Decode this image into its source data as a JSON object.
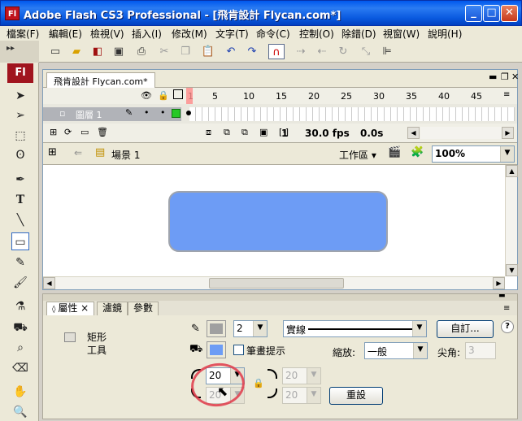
{
  "window": {
    "title": "Adobe Flash CS3 Professional - [飛肯設計  Flycan.com*]",
    "icon_text": "Fl",
    "minimize": "_",
    "maximize": "□",
    "close": "✕"
  },
  "menu": [
    "檔案(F)",
    "編輯(E)",
    "檢視(V)",
    "插入(I)",
    "修改(M)",
    "文字(T)",
    "命令(C)",
    "控制(O)",
    "除錯(D)",
    "視窗(W)",
    "說明(H)"
  ],
  "toolbar_icons": [
    "new-icon",
    "open-icon",
    "bridge-icon",
    "save-icon",
    "print-icon",
    "cut-icon",
    "copy-icon",
    "paste-icon",
    "undo-icon",
    "redo-icon",
    "snap-magnet-icon",
    "smooth-icon",
    "straighten-icon",
    "rotate-icon",
    "scale-icon",
    "align-icon"
  ],
  "tools": {
    "logo": "Fl"
  },
  "document": {
    "tab": "飛肯設計  Flycan.com*",
    "frame_numbers": [
      "1",
      "5",
      "10",
      "15",
      "20",
      "25",
      "30",
      "35",
      "40",
      "45"
    ],
    "layer_name": "圖層 1",
    "current_frame": "1",
    "fps": "30.0 fps",
    "elapsed": "0.0s",
    "scene": "場景 1",
    "workspace": "工作區 ▾",
    "zoom": "100%",
    "shape_color": "#6d9cf5"
  },
  "properties": {
    "tabs": [
      "屬性",
      "濾鏡",
      "參數"
    ],
    "tab_close": "×",
    "tool_name_1": "矩形",
    "tool_name_2": "工具",
    "stroke_height": "2",
    "stroke_style": "實線",
    "custom_button": "自訂...",
    "stroke_hinting_label": "筆畫提示",
    "scale_label": "縮放:",
    "scale_value": "一般",
    "miter_label": "尖角:",
    "miter_value": "3",
    "corner_radius_1": "20",
    "corner_radius_2": "20",
    "corner_radius_3": "20",
    "corner_radius_4": "20",
    "reset_button": "重設",
    "fill_color": "#6d9cf5",
    "stroke_color": "#a0a0a0"
  }
}
